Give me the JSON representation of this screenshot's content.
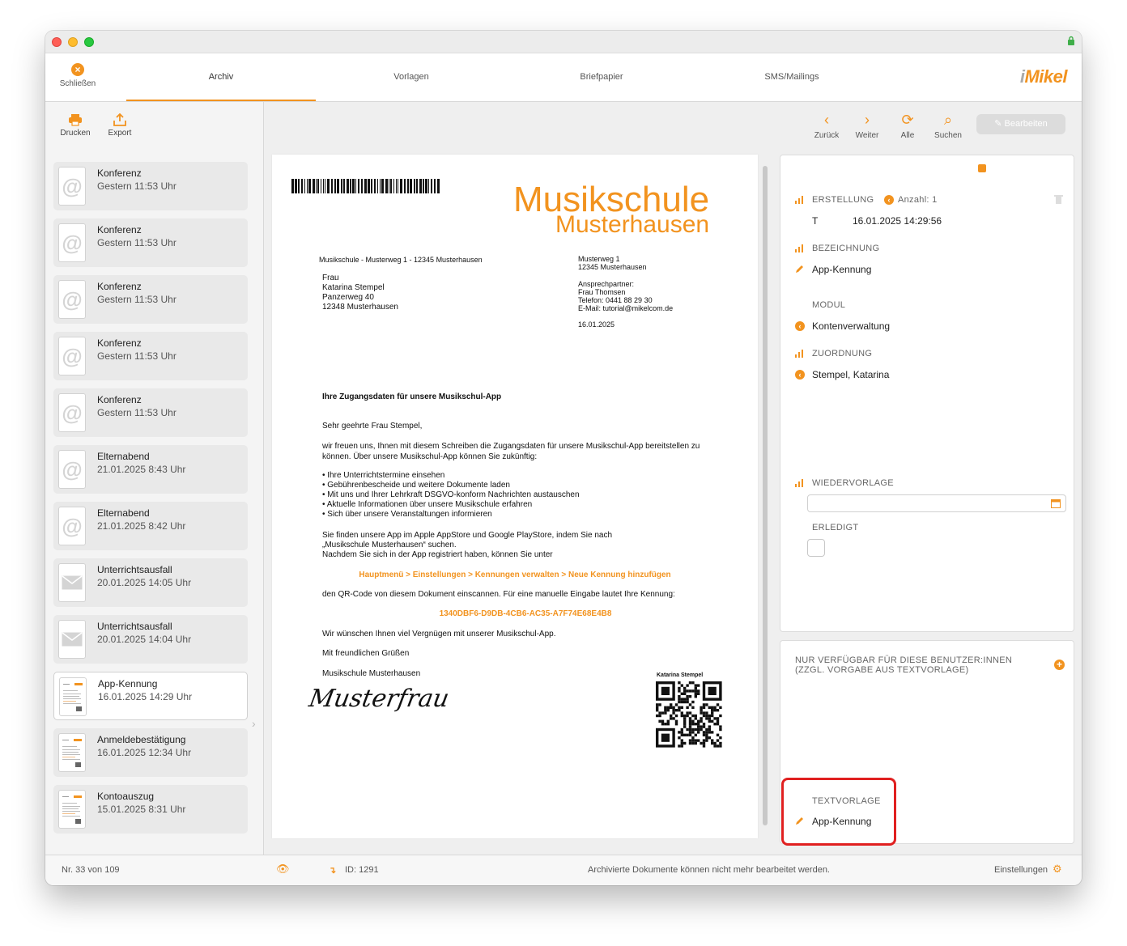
{
  "nav": {
    "close_label": "Schließen",
    "tabs": [
      "Archiv",
      "Vorlagen",
      "Briefpapier",
      "SMS/Mailings"
    ],
    "logo": "Mikel",
    "logo_prefix": "i"
  },
  "sidebar": {
    "tools": [
      "Drucken",
      "Export"
    ],
    "items": [
      {
        "title": "Konferenz",
        "subtitle": "Gestern 11:53 Uhr",
        "icon": "at-icon"
      },
      {
        "title": "Konferenz",
        "subtitle": "Gestern 11:53 Uhr",
        "icon": "at-icon"
      },
      {
        "title": "Konferenz",
        "subtitle": "Gestern 11:53 Uhr",
        "icon": "at-icon"
      },
      {
        "title": "Konferenz",
        "subtitle": "Gestern 11:53 Uhr",
        "icon": "at-icon"
      },
      {
        "title": "Konferenz",
        "subtitle": "Gestern 11:53 Uhr",
        "icon": "at-icon"
      },
      {
        "title": "Elternabend",
        "subtitle": "21.01.2025 8:43 Uhr",
        "icon": "at-icon"
      },
      {
        "title": "Elternabend",
        "subtitle": "21.01.2025 8:42 Uhr",
        "icon": "at-icon"
      },
      {
        "title": "Unterrichtsausfall",
        "subtitle": "20.01.2025 14:05 Uhr",
        "icon": "envelope-icon"
      },
      {
        "title": "Unterrichtsausfall",
        "subtitle": "20.01.2025 14:04 Uhr",
        "icon": "envelope-icon"
      },
      {
        "title": "App-Kennung",
        "subtitle": "16.01.2025 14:29 Uhr",
        "icon": "document-thumbnail-icon"
      },
      {
        "title": "Anmeldebestätigung",
        "subtitle": "16.01.2025 12:34 Uhr",
        "icon": "document-thumbnail-icon"
      },
      {
        "title": "Kontoauszug",
        "subtitle": "15.01.2025 8:31 Uhr",
        "icon": "document-thumbnail-icon"
      }
    ]
  },
  "toolbar": {
    "back": "Zurück",
    "next": "Weiter",
    "all": "Alle",
    "search": "Suchen",
    "edit": "Bearbeiten"
  },
  "document": {
    "logo_line1": "Musikschule",
    "logo_line2": "Musterhausen",
    "sender_line": "Musikschule - Musterweg 1 - 12345 Musterhausen",
    "recipient": [
      "Frau",
      "Katarina Stempel",
      "Panzerweg 40",
      "12348 Musterhausen"
    ],
    "sender_address": [
      "Musterweg 1",
      "12345 Musterhausen"
    ],
    "contact": [
      "Ansprechpartner:",
      "Frau Thomsen",
      "Telefon: 0441 88 29 30",
      "E-Mail: tutorial@mikelcom.de"
    ],
    "date": "16.01.2025",
    "subject": "Ihre Zugangsdaten für unsere Musikschul-App",
    "greeting": "Sehr geehrte Frau Stempel,",
    "intro": "wir freuen uns, Ihnen mit diesem Schreiben die Zugangsdaten für unsere Musikschul-App bereitstellen zu können. Über unsere Musikschul-App können Sie zukünftig:",
    "bullets": [
      "• Ihre Unterrichtstermine einsehen",
      "• Gebührenbescheide und weitere Dokumente laden",
      "• Mit uns und Ihrer Lehrkraft DSGVO-konform Nachrichten austauschen",
      "• Aktuelle Informationen über unsere Musikschule erfahren",
      "• Sich über unsere Veranstaltungen informieren"
    ],
    "store_text": [
      "Sie finden unsere App im Apple AppStore und Google PlayStore, indem Sie nach",
      "„Musikschule Musterhausen“ suchen.",
      "Nachdem Sie sich in der App registriert haben, können Sie unter"
    ],
    "menu_path": "Hauptmenü > Einstellungen > Kennungen verwalten > Neue Kennung hinzufügen",
    "qr_text": "den QR-Code von diesem Dokument einscannen. Für eine manuelle Eingabe lautet Ihre Kennung:",
    "code": "1340DBF6-D9DB-4CB6-AC35-A7F74E68E4B8",
    "wish": "Wir wünschen Ihnen viel Vergnügen mit unserer Musikschul-App.",
    "closing": "Mit freundlichen Grüßen",
    "signoff": "Musikschule Musterhausen",
    "signature": "Musterfrau",
    "qr_label": "Katarina Stempel"
  },
  "details": {
    "creation_label": "ERSTELLUNG",
    "count_label": "Anzahl: 1",
    "creation_user": "T",
    "creation_date": "16.01.2025 14:29:56",
    "designation_label": "BEZEICHNUNG",
    "designation_value": "App-Kennung",
    "module_label": "MODUL",
    "module_value": "Kontenverwaltung",
    "assignment_label": "ZUORDNUNG",
    "assignment_value": "Stempel, Katarina",
    "resubmission_label": "WIEDERVORLAGE",
    "resubmission_value": "",
    "done_label": "ERLEDIGT",
    "done_checked": false
  },
  "availability": {
    "label": "NUR VERFÜGBAR FÜR DIESE BENUTZER:INNEN (ZZGL. VORGABE AUS TEXTVORLAGE)",
    "template_label": "TEXTVORLAGE",
    "template_value": "App-Kennung"
  },
  "status": {
    "record": "Nr. 33 von 109",
    "id": "ID: 1291",
    "message": "Archivierte Dokumente können nicht mehr bearbeitet werden.",
    "settings": "Einstellungen"
  },
  "colors": {
    "accent": "#f2931f",
    "highlight": "#e02020"
  }
}
